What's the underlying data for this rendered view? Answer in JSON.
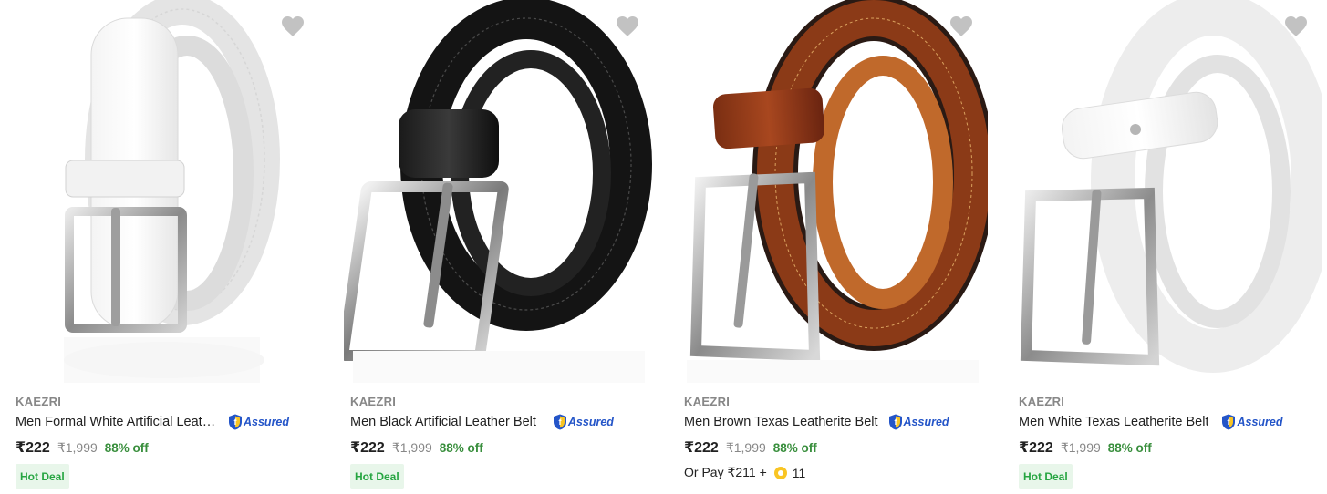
{
  "assured_label": "Assured",
  "colors": {
    "discount": "#388e3c",
    "hot_deal_bg": "#e8f6ea",
    "hot_deal_text": "#26a541",
    "assured_blue": "#2455c8",
    "supercoin": "#f9c524"
  },
  "products": [
    {
      "brand": "KAEZRI",
      "title": "Men Formal White Artificial Leather Belt",
      "price": "₹222",
      "mrp": "₹1,999",
      "discount": "88% off",
      "tag": "Hot Deal",
      "image_icon": "white-belt-image"
    },
    {
      "brand": "KAEZRI",
      "title": "Men Black Artificial Leather Belt",
      "price": "₹222",
      "mrp": "₹1,999",
      "discount": "88% off",
      "tag": "Hot Deal",
      "image_icon": "black-belt-image"
    },
    {
      "brand": "KAEZRI",
      "title": "Men Brown Texas Leatherite Belt",
      "price": "₹222",
      "mrp": "₹1,999",
      "discount": "88% off",
      "pay_prefix": "Or Pay ₹211 +",
      "supercoins": "11",
      "image_icon": "brown-belt-image"
    },
    {
      "brand": "KAEZRI",
      "title": "Men White Texas Leatherite Belt",
      "price": "₹222",
      "mrp": "₹1,999",
      "discount": "88% off",
      "tag": "Hot Deal",
      "image_icon": "white-belt-image"
    }
  ]
}
